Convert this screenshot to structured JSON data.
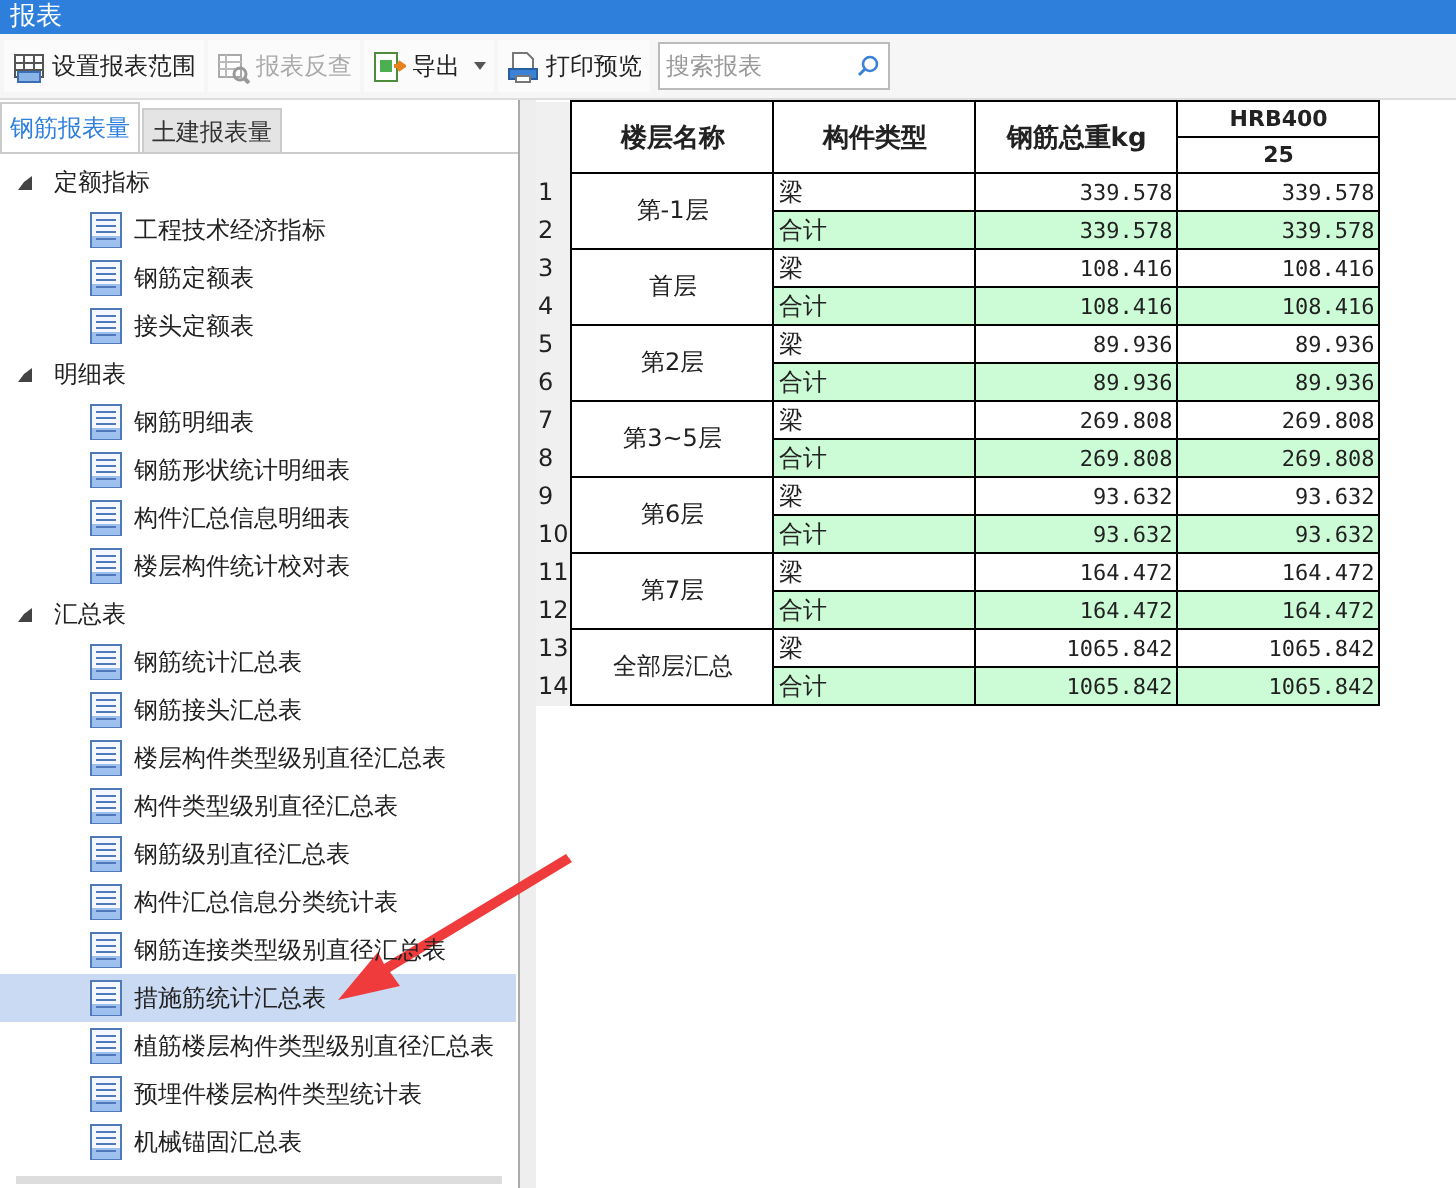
{
  "window": {
    "title": "报表"
  },
  "toolbar": [
    {
      "kind": "table",
      "label": "设置报表范围",
      "disabled": false
    },
    {
      "kind": "inspect",
      "label": "报表反查",
      "disabled": true
    },
    {
      "kind": "export",
      "label": "导出",
      "disabled": false,
      "dropdown": true
    },
    {
      "kind": "print",
      "label": "打印预览",
      "disabled": false
    }
  ],
  "search": {
    "placeholder": "搜索报表"
  },
  "tabs": [
    {
      "label": "钢筋报表量",
      "selected": true
    },
    {
      "label": "土建报表量",
      "selected": false
    }
  ],
  "tree": [
    {
      "label": "定额指标",
      "expanded": true,
      "children": [
        {
          "label": "工程技术经济指标",
          "selected": false
        },
        {
          "label": "钢筋定额表",
          "selected": false
        },
        {
          "label": "接头定额表",
          "selected": false
        }
      ]
    },
    {
      "label": "明细表",
      "expanded": true,
      "children": [
        {
          "label": "钢筋明细表",
          "selected": false
        },
        {
          "label": "钢筋形状统计明细表",
          "selected": false
        },
        {
          "label": "构件汇总信息明细表",
          "selected": false
        },
        {
          "label": "楼层构件统计校对表",
          "selected": false
        }
      ]
    },
    {
      "label": "汇总表",
      "expanded": true,
      "children": [
        {
          "label": "钢筋统计汇总表",
          "selected": false
        },
        {
          "label": "钢筋接头汇总表",
          "selected": false
        },
        {
          "label": "楼层构件类型级别直径汇总表",
          "selected": false
        },
        {
          "label": "构件类型级别直径汇总表",
          "selected": false
        },
        {
          "label": "钢筋级别直径汇总表",
          "selected": false
        },
        {
          "label": "构件汇总信息分类统计表",
          "selected": false
        },
        {
          "label": "钢筋连接类型级别直径汇总表",
          "selected": false
        },
        {
          "label": "措施筋统计汇总表",
          "selected": true
        },
        {
          "label": "植筋楼层构件类型级别直径汇总表",
          "selected": false
        },
        {
          "label": "预埋件楼层构件类型统计表",
          "selected": false
        },
        {
          "label": "机械锚固汇总表",
          "selected": false
        }
      ]
    }
  ],
  "table": {
    "columns": [
      "楼层名称",
      "构件类型",
      "钢筋总重kg"
    ],
    "grade": "HRB400",
    "diameter": "25",
    "groups": [
      {
        "floor": "第-1层",
        "rows": [
          {
            "number": "1",
            "type": "梁",
            "total": "339.578",
            "value": "339.578",
            "kind": "item"
          },
          {
            "number": "2",
            "type": "合计",
            "total": "339.578",
            "value": "339.578",
            "kind": "sum"
          }
        ]
      },
      {
        "floor": "首层",
        "rows": [
          {
            "number": "3",
            "type": "梁",
            "total": "108.416",
            "value": "108.416",
            "kind": "item"
          },
          {
            "number": "4",
            "type": "合计",
            "total": "108.416",
            "value": "108.416",
            "kind": "sum"
          }
        ]
      },
      {
        "floor": "第2层",
        "rows": [
          {
            "number": "5",
            "type": "梁",
            "total": "89.936",
            "value": "89.936",
            "kind": "item"
          },
          {
            "number": "6",
            "type": "合计",
            "total": "89.936",
            "value": "89.936",
            "kind": "sum"
          }
        ]
      },
      {
        "floor": "第3~5层",
        "rows": [
          {
            "number": "7",
            "type": "梁",
            "total": "269.808",
            "value": "269.808",
            "kind": "item"
          },
          {
            "number": "8",
            "type": "合计",
            "total": "269.808",
            "value": "269.808",
            "kind": "sum"
          }
        ]
      },
      {
        "floor": "第6层",
        "rows": [
          {
            "number": "9",
            "type": "梁",
            "total": "93.632",
            "value": "93.632",
            "kind": "item"
          },
          {
            "number": "10",
            "type": "合计",
            "total": "93.632",
            "value": "93.632",
            "kind": "sum"
          }
        ]
      },
      {
        "floor": "第7层",
        "rows": [
          {
            "number": "11",
            "type": "梁",
            "total": "164.472",
            "value": "164.472",
            "kind": "item"
          },
          {
            "number": "12",
            "type": "合计",
            "total": "164.472",
            "value": "164.472",
            "kind": "sum"
          }
        ]
      },
      {
        "floor": "全部层汇总",
        "rows": [
          {
            "number": "13",
            "type": "梁",
            "total": "1065.842",
            "value": "1065.842",
            "kind": "item"
          },
          {
            "number": "14",
            "type": "合计",
            "total": "1065.842",
            "value": "1065.842",
            "kind": "sum"
          }
        ]
      }
    ]
  }
}
